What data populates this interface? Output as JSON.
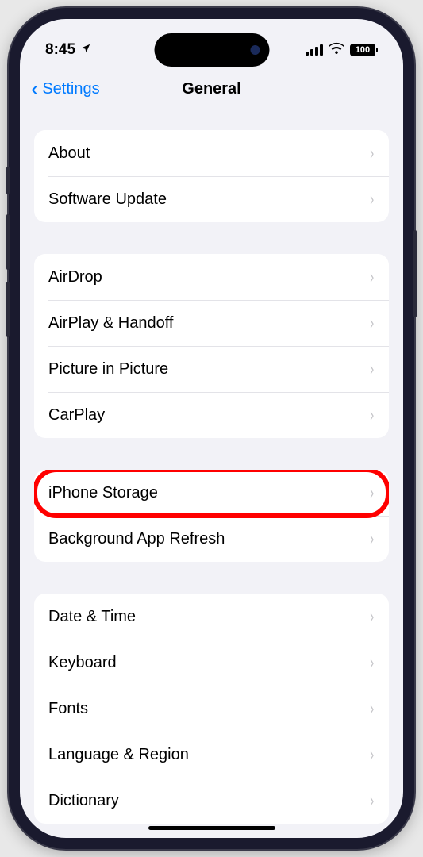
{
  "status_bar": {
    "time": "8:45",
    "battery": "100"
  },
  "nav": {
    "back_label": "Settings",
    "title": "General"
  },
  "groups": [
    {
      "rows": [
        {
          "label": "About",
          "name": "row-about"
        },
        {
          "label": "Software Update",
          "name": "row-software-update"
        }
      ]
    },
    {
      "rows": [
        {
          "label": "AirDrop",
          "name": "row-airdrop"
        },
        {
          "label": "AirPlay & Handoff",
          "name": "row-airplay-handoff"
        },
        {
          "label": "Picture in Picture",
          "name": "row-picture-in-picture"
        },
        {
          "label": "CarPlay",
          "name": "row-carplay"
        }
      ]
    },
    {
      "rows": [
        {
          "label": "iPhone Storage",
          "name": "row-iphone-storage",
          "highlighted": true
        },
        {
          "label": "Background App Refresh",
          "name": "row-background-app-refresh"
        }
      ]
    },
    {
      "rows": [
        {
          "label": "Date & Time",
          "name": "row-date-time"
        },
        {
          "label": "Keyboard",
          "name": "row-keyboard"
        },
        {
          "label": "Fonts",
          "name": "row-fonts"
        },
        {
          "label": "Language & Region",
          "name": "row-language-region"
        },
        {
          "label": "Dictionary",
          "name": "row-dictionary"
        }
      ]
    }
  ]
}
